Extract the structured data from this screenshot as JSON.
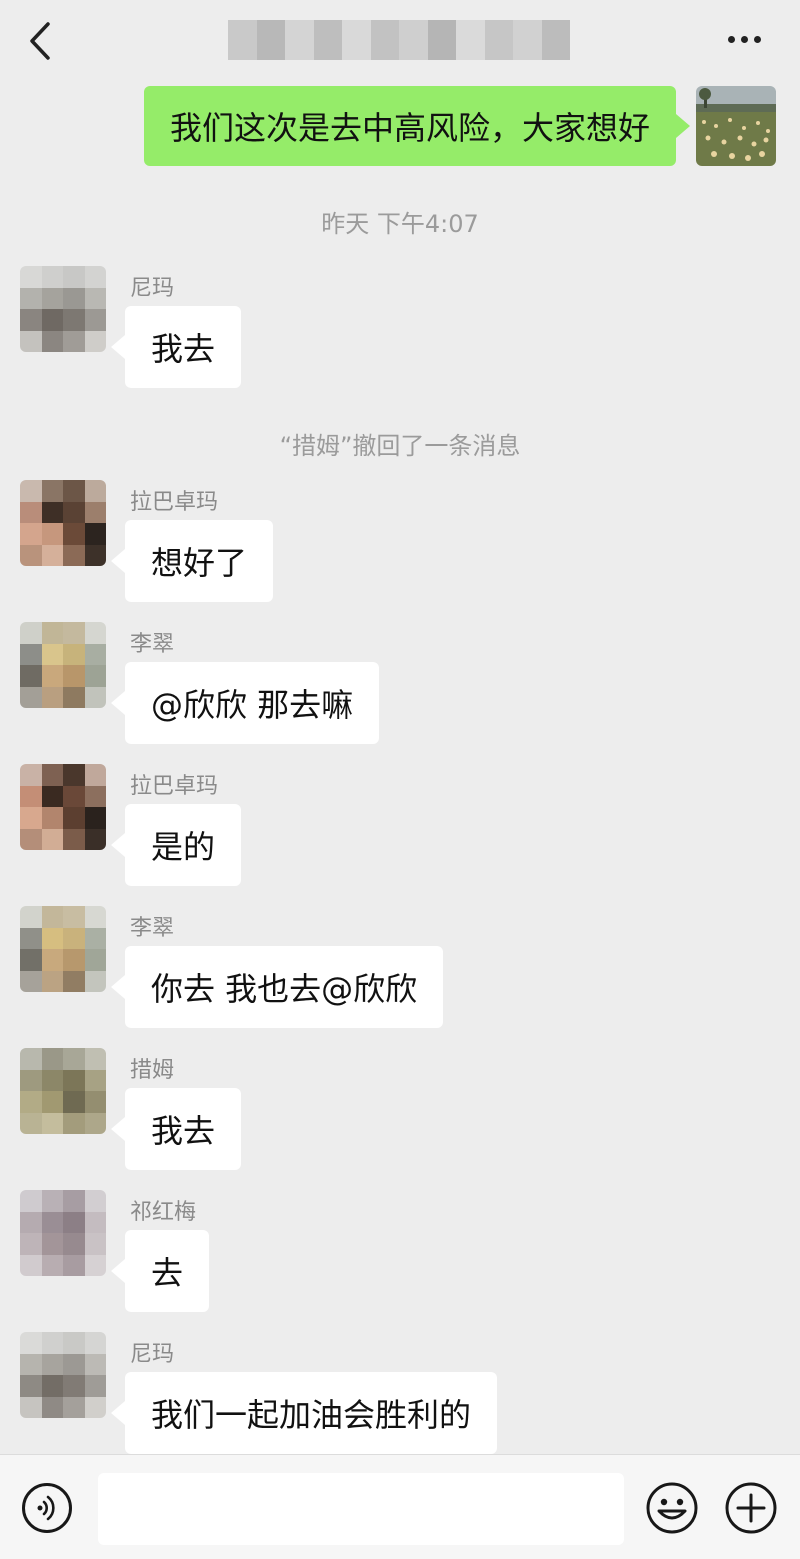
{
  "header": {
    "title_obscured": true
  },
  "my_message": {
    "text": "我们这次是去中高风险，大家想好"
  },
  "timestamp": "昨天 下午4:07",
  "recall_notice": "“措姆”撤回了一条消息",
  "messages": [
    {
      "sender": "尼玛",
      "text": "我去"
    },
    {
      "sender": "拉巴卓玛",
      "text": "想好了"
    },
    {
      "sender": "李翠",
      "text": "@欣欣  那去嘛"
    },
    {
      "sender": "拉巴卓玛",
      "text": "是的"
    },
    {
      "sender": "李翠",
      "text": "你去  我也去@欣欣"
    },
    {
      "sender": "措姆",
      "text": "我去"
    },
    {
      "sender": "祁红梅",
      "text": "去"
    },
    {
      "sender": "尼玛",
      "text": "我们一起加油会胜利的"
    }
  ],
  "input": {
    "value": ""
  },
  "colors": {
    "background": "#ededed",
    "my_bubble": "#95ec69",
    "other_bubble": "#ffffff",
    "meta_text": "#9b9b9b"
  },
  "icons": {
    "back": "chevron-left-icon",
    "more": "more-dots-icon",
    "voice": "voice-icon",
    "emoji": "emoji-icon",
    "plus": "plus-icon"
  }
}
